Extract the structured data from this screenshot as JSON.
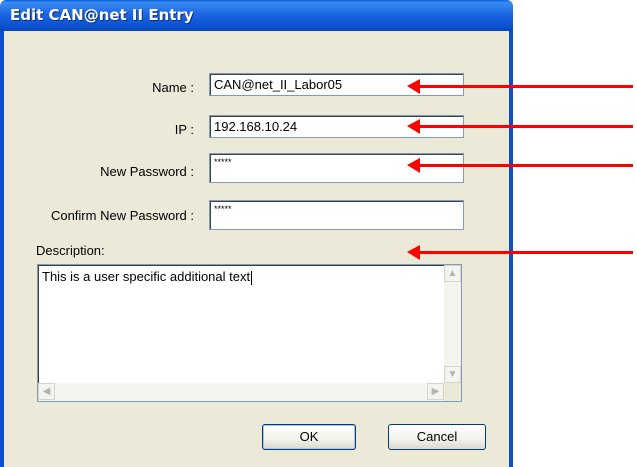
{
  "window": {
    "title": "Edit CAN@net II Entry"
  },
  "form": {
    "name_label": "Name :",
    "name_value": "CAN@net_II_Labor05",
    "ip_label": "IP :",
    "ip_value": "192.168.10.24",
    "new_password_label": "New Password :",
    "new_password_value": "*****",
    "confirm_password_label": "Confirm New Password :",
    "confirm_password_value": "*****",
    "description_label": "Description:",
    "description_value": "This is a user specific additional text"
  },
  "buttons": {
    "ok_label": "OK",
    "cancel_label": "Cancel"
  },
  "scrollbar_glyphs": {
    "up": "▲",
    "down": "▼",
    "left": "◀",
    "right": "▶"
  },
  "annotation": {
    "arrow_color": "#ff0000"
  },
  "colors": {
    "titlebar": "#0b52d0",
    "dialog_bg": "#ece9d8"
  }
}
